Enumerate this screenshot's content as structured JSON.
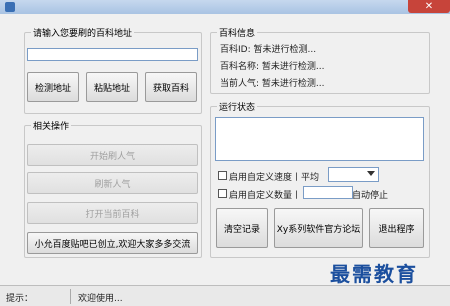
{
  "window": {
    "title": "",
    "close_glyph": "✕"
  },
  "url_group": {
    "title": "请输入您要刷的百科地址",
    "url_value": "",
    "buttons": {
      "detect": "检测地址",
      "paste": "粘贴地址",
      "fetch": "获取百科"
    }
  },
  "info_group": {
    "title": "百科信息",
    "rows": [
      {
        "label": "百科ID:",
        "value": "暂未进行检测..."
      },
      {
        "label": "百科名称:",
        "value": "暂未进行检测..."
      },
      {
        "label": "当前人气:",
        "value": "暂未进行检测..."
      }
    ]
  },
  "ops_group": {
    "title": "相关操作",
    "buttons": {
      "start": "开始刷人气",
      "refresh": "刷新人气",
      "open": "打开当前百科",
      "forum": "小允百度贴吧已创立,欢迎大家多多交流"
    }
  },
  "status_group": {
    "title": "运行状态",
    "log": "",
    "option1_label": "启用自定义速度丨平均",
    "option1_select": "",
    "option2_label": "启用自定义数量丨",
    "option2_value": "",
    "option2_suffix": "自动停止",
    "buttons": {
      "clear": "清空记录",
      "site": "Xy系列软件官方论坛",
      "exit": "退出程序"
    }
  },
  "statusbar": {
    "label": "提示：",
    "message": "欢迎使用..."
  },
  "watermark": "最需教育"
}
